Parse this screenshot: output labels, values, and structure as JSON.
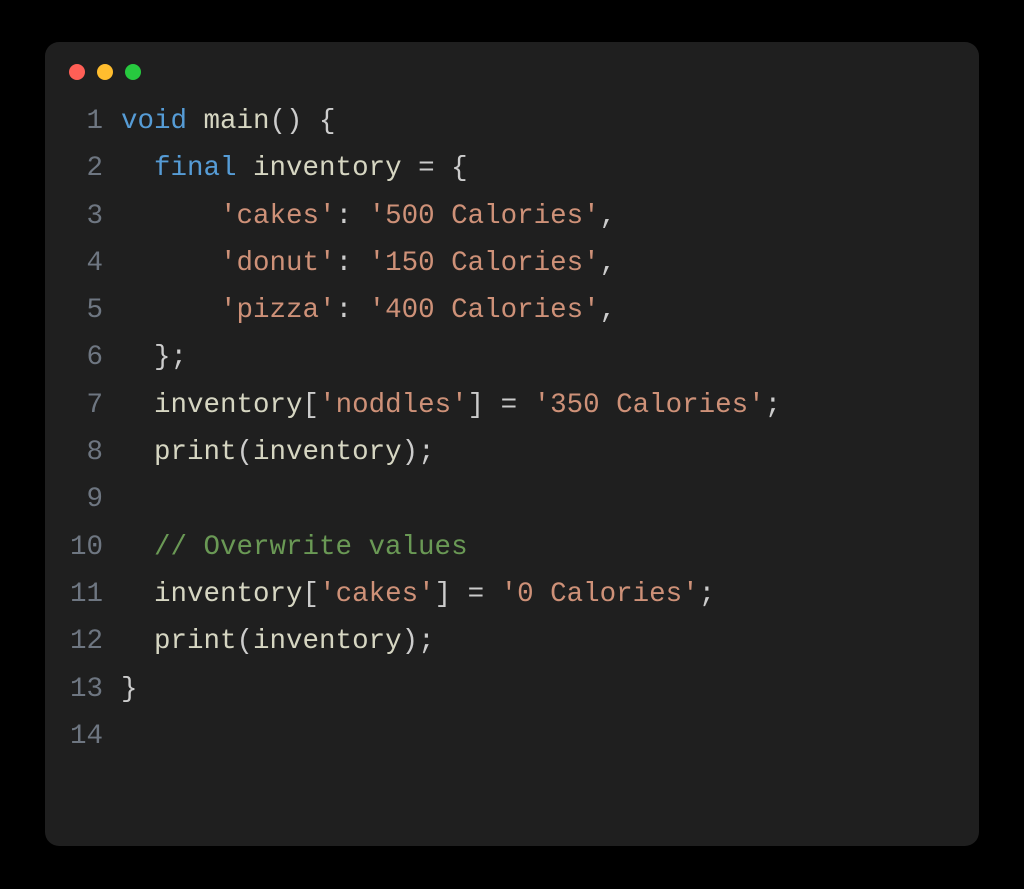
{
  "window": {
    "dots": {
      "close": "#ff5f56",
      "min": "#ffbd2e",
      "max": "#27c93f"
    }
  },
  "code": {
    "lines": [
      {
        "num": "1",
        "tokens": [
          {
            "cls": "tok-keyword",
            "t": "void"
          },
          {
            "cls": "tok-punct",
            "t": " "
          },
          {
            "cls": "tok-ident",
            "t": "main"
          },
          {
            "cls": "tok-punct",
            "t": "() {"
          }
        ]
      },
      {
        "num": "2",
        "tokens": [
          {
            "cls": "tok-punct",
            "t": "  "
          },
          {
            "cls": "tok-keyword",
            "t": "final"
          },
          {
            "cls": "tok-punct",
            "t": " "
          },
          {
            "cls": "tok-ident",
            "t": "inventory"
          },
          {
            "cls": "tok-punct",
            "t": " = {"
          }
        ]
      },
      {
        "num": "3",
        "tokens": [
          {
            "cls": "tok-punct",
            "t": "      "
          },
          {
            "cls": "tok-string",
            "t": "'cakes'"
          },
          {
            "cls": "tok-punct",
            "t": ": "
          },
          {
            "cls": "tok-string",
            "t": "'500 Calories'"
          },
          {
            "cls": "tok-punct",
            "t": ","
          }
        ]
      },
      {
        "num": "4",
        "tokens": [
          {
            "cls": "tok-punct",
            "t": "      "
          },
          {
            "cls": "tok-string",
            "t": "'donut'"
          },
          {
            "cls": "tok-punct",
            "t": ": "
          },
          {
            "cls": "tok-string",
            "t": "'150 Calories'"
          },
          {
            "cls": "tok-punct",
            "t": ","
          }
        ]
      },
      {
        "num": "5",
        "tokens": [
          {
            "cls": "tok-punct",
            "t": "      "
          },
          {
            "cls": "tok-string",
            "t": "'pizza'"
          },
          {
            "cls": "tok-punct",
            "t": ": "
          },
          {
            "cls": "tok-string",
            "t": "'400 Calories'"
          },
          {
            "cls": "tok-punct",
            "t": ","
          }
        ]
      },
      {
        "num": "6",
        "tokens": [
          {
            "cls": "tok-punct",
            "t": "  };"
          }
        ]
      },
      {
        "num": "7",
        "tokens": [
          {
            "cls": "tok-punct",
            "t": "  "
          },
          {
            "cls": "tok-ident",
            "t": "inventory"
          },
          {
            "cls": "tok-punct",
            "t": "["
          },
          {
            "cls": "tok-string",
            "t": "'noddles'"
          },
          {
            "cls": "tok-punct",
            "t": "] = "
          },
          {
            "cls": "tok-string",
            "t": "'350 Calories'"
          },
          {
            "cls": "tok-punct",
            "t": ";"
          }
        ]
      },
      {
        "num": "8",
        "tokens": [
          {
            "cls": "tok-punct",
            "t": "  "
          },
          {
            "cls": "tok-call",
            "t": "print"
          },
          {
            "cls": "tok-punct",
            "t": "("
          },
          {
            "cls": "tok-ident",
            "t": "inventory"
          },
          {
            "cls": "tok-punct",
            "t": ");"
          }
        ]
      },
      {
        "num": "9",
        "tokens": [
          {
            "cls": "tok-punct",
            "t": ""
          }
        ]
      },
      {
        "num": "10",
        "tokens": [
          {
            "cls": "tok-punct",
            "t": "  "
          },
          {
            "cls": "tok-comment",
            "t": "// Overwrite values"
          }
        ]
      },
      {
        "num": "11",
        "tokens": [
          {
            "cls": "tok-punct",
            "t": "  "
          },
          {
            "cls": "tok-ident",
            "t": "inventory"
          },
          {
            "cls": "tok-punct",
            "t": "["
          },
          {
            "cls": "tok-string",
            "t": "'cakes'"
          },
          {
            "cls": "tok-punct",
            "t": "] = "
          },
          {
            "cls": "tok-string",
            "t": "'0 Calories'"
          },
          {
            "cls": "tok-punct",
            "t": ";"
          }
        ]
      },
      {
        "num": "12",
        "tokens": [
          {
            "cls": "tok-punct",
            "t": "  "
          },
          {
            "cls": "tok-call",
            "t": "print"
          },
          {
            "cls": "tok-punct",
            "t": "("
          },
          {
            "cls": "tok-ident",
            "t": "inventory"
          },
          {
            "cls": "tok-punct",
            "t": ");"
          }
        ]
      },
      {
        "num": "13",
        "tokens": [
          {
            "cls": "tok-punct",
            "t": "}"
          }
        ]
      },
      {
        "num": "14",
        "tokens": [
          {
            "cls": "tok-punct",
            "t": ""
          }
        ]
      }
    ]
  }
}
